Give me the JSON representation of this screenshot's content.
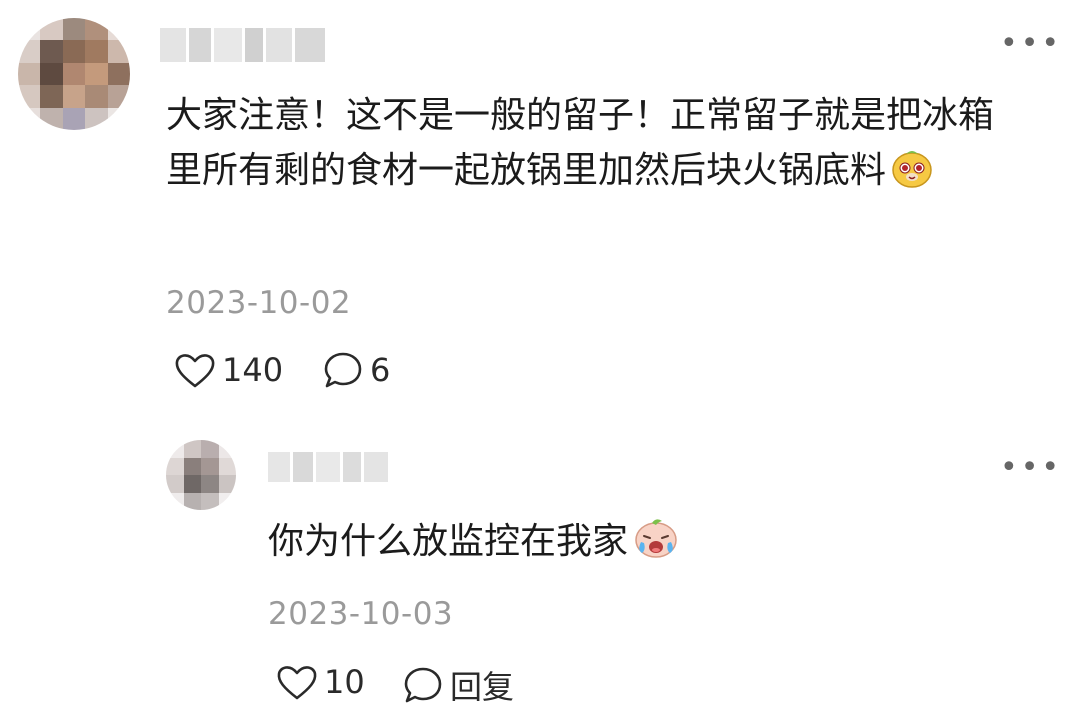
{
  "comment": {
    "text": "大家注意！这不是一般的留子！正常留子就是把冰箱里所有剩的食材一起放锅里加然后块火锅底料",
    "emoji": "monkey-face-emoji",
    "date": "2023-10-02",
    "likes": "140",
    "replies": "6",
    "more_icon": "more-dots-icon"
  },
  "reply": {
    "text": "你为什么放监控在我家",
    "emoji": "crying-face-emoji",
    "date": "2023-10-03",
    "likes": "10",
    "reply_label": "回复",
    "more_icon": "more-dots-icon"
  },
  "colors": {
    "date": "#9a9a9a",
    "text": "#1b1b1b",
    "icon": "#2a2a2a"
  }
}
